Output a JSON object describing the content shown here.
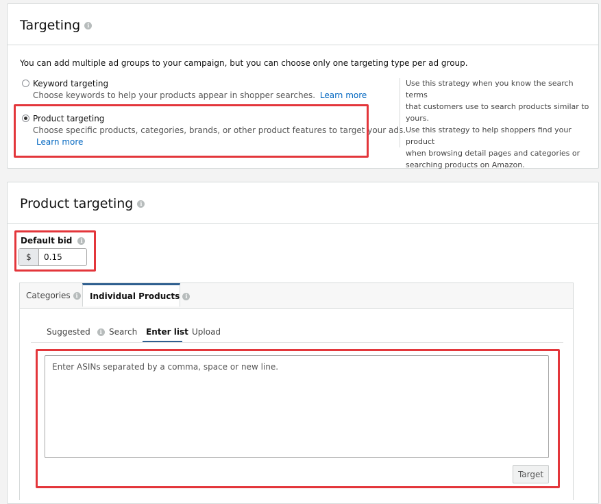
{
  "targeting": {
    "title": "Targeting",
    "intro": "You can add multiple ad groups to your campaign, but you can choose only one targeting type per ad group.",
    "options": [
      {
        "label": "Keyword targeting",
        "description": "Choose keywords to help your products appear in shopper searches.",
        "link": "Learn more",
        "selected": false
      },
      {
        "label": "Product targeting",
        "description": "Choose specific products, categories, brands, or other product features to target your ads.",
        "link": "Learn more",
        "selected": true
      }
    ],
    "help_lines": [
      "Use this strategy when you know the search terms",
      "that customers use to search products similar to",
      "yours.",
      "Use this strategy to help shoppers find your product",
      "when browsing detail pages and categories or",
      "searching products on Amazon."
    ]
  },
  "product_targeting": {
    "title": "Product targeting",
    "default_bid_label": "Default bid",
    "currency": "$",
    "default_bid_value": "0.15",
    "tabs": [
      "Categories",
      "Individual Products"
    ],
    "active_tab": "Individual Products",
    "subtabs": [
      "Suggested",
      "Search",
      "Enter list",
      "Upload"
    ],
    "active_subtab": "Enter list",
    "asin_placeholder": "Enter ASINs separated by a comma, space or new line.",
    "target_button": "Target"
  },
  "colors": {
    "highlight": "#e3363b",
    "link": "#0066c0",
    "active_tab_accent": "#2f5f8f"
  }
}
